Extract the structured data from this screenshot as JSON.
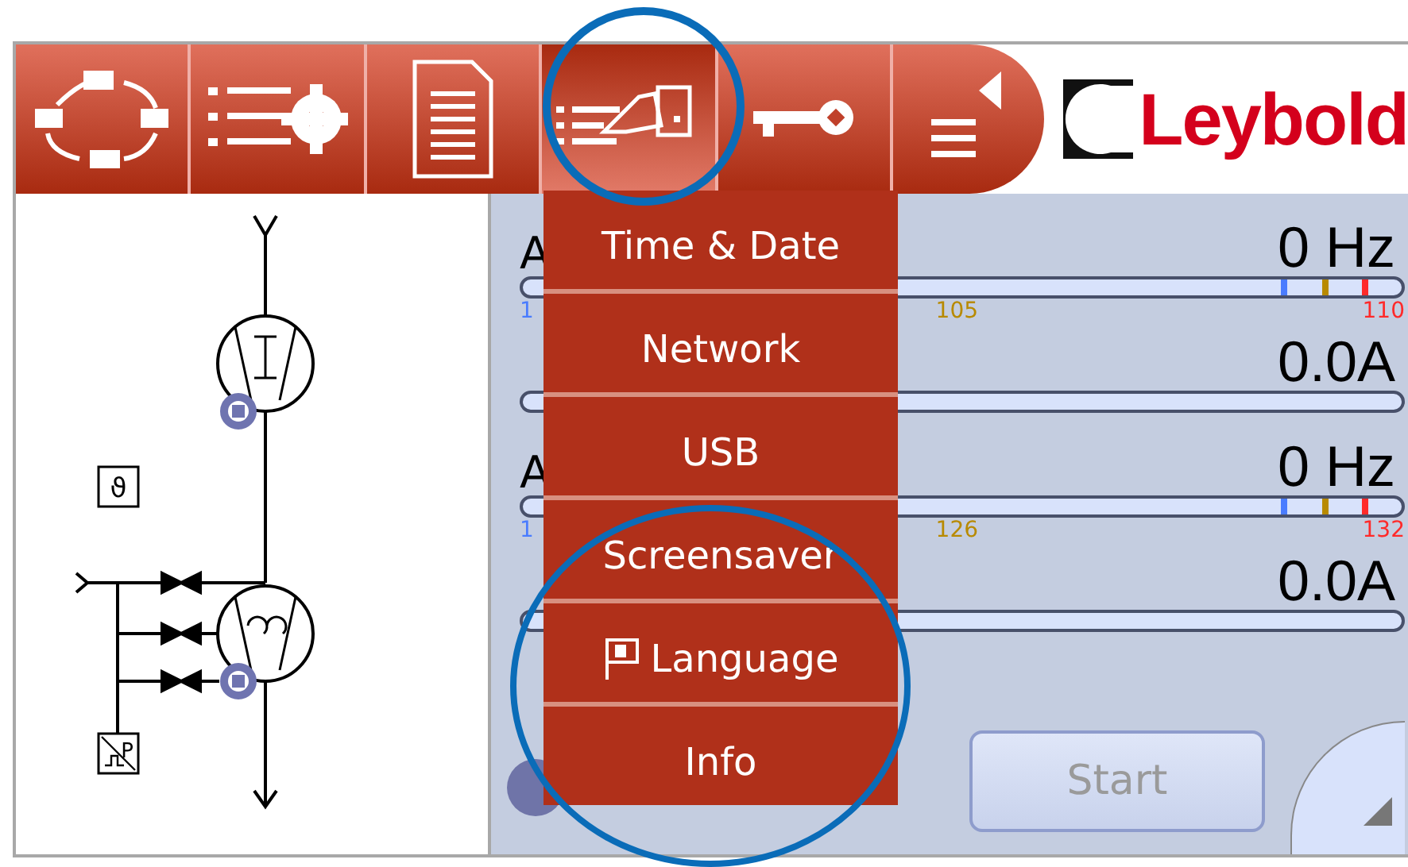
{
  "toolbar": {
    "buttons": [
      {
        "selected": false
      },
      {
        "selected": false
      },
      {
        "selected": false
      },
      {
        "selected": true
      },
      {
        "selected": false
      },
      {
        "selected": false
      }
    ],
    "logo": "Leybold"
  },
  "diagram": {
    "temperature_label": "ϑ",
    "pressure_label": "P"
  },
  "groups": [
    {
      "rows": [
        {
          "kind": "frequency",
          "label": "A",
          "reading": "0 Hz",
          "level": 0,
          "scale": [
            {
              "text": "1",
              "color": "#4a7cff"
            },
            {
              "text": "105",
              "color": "#b88a00"
            },
            {
              "text": "110",
              "color": "#ff2a2a"
            }
          ]
        },
        {
          "kind": "current",
          "reading": "0.0A",
          "level": 0
        }
      ]
    },
    {
      "rows": [
        {
          "kind": "frequency",
          "label": "A",
          "reading": "0 Hz",
          "level": 0,
          "scale": [
            {
              "text": "1",
              "color": "#4a7cff"
            },
            {
              "text": "126",
              "color": "#b88a00"
            },
            {
              "text": "132",
              "color": "#ff2a2a"
            }
          ]
        },
        {
          "kind": "current",
          "reading": "0.0A",
          "level": 0
        }
      ]
    }
  ],
  "start_button": {
    "label": "Start",
    "disabled": true
  },
  "menu": {
    "items": [
      {
        "kind": "plain",
        "label": "Time & Date"
      },
      {
        "kind": "plain",
        "label": "Network"
      },
      {
        "kind": "plain",
        "label": "USB"
      },
      {
        "kind": "plain",
        "label": "Screensaver"
      },
      {
        "kind": "flag",
        "label": "Language"
      },
      {
        "kind": "plain",
        "label": "Info"
      }
    ]
  }
}
